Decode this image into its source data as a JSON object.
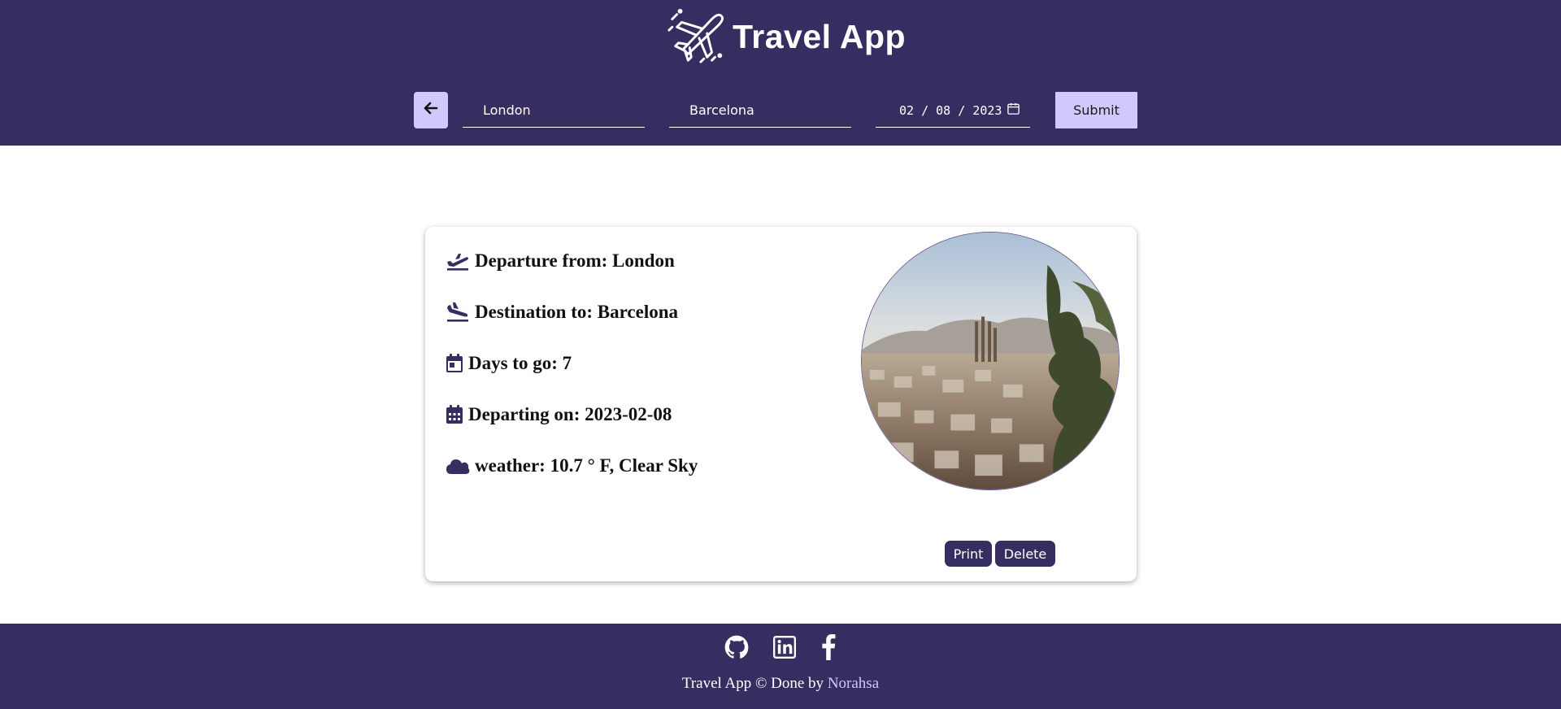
{
  "colors": {
    "brand_bg": "#382d60",
    "accent": "#cfcafb",
    "text_dark": "#111111",
    "white": "#ffffff"
  },
  "header": {
    "logo_icon": "airplane-icon",
    "title": "Travel App"
  },
  "search": {
    "back_icon": "arrow-left-icon",
    "from_value": "London",
    "to_value": "Barcelona",
    "date_value": "02 / 08 / 2023",
    "date_icon": "calendar-icon",
    "submit_label": "Submit"
  },
  "trip": {
    "rows": [
      {
        "icon": "plane-departure-icon",
        "text": "Departure from: London"
      },
      {
        "icon": "plane-arrival-icon",
        "text": "Destination to: Barcelona"
      },
      {
        "icon": "calendar-day-icon",
        "text": "Days to go: 7"
      },
      {
        "icon": "calendar-days-icon",
        "text": "Departing on: 2023-02-08"
      },
      {
        "icon": "cloud-icon",
        "text": "weather: 10.7 ° F, Clear Sky"
      }
    ],
    "photo_icon": "city-photo",
    "print_label": "Print",
    "delete_label": "Delete"
  },
  "footer": {
    "social": [
      "github-icon",
      "linkedin-icon",
      "facebook-icon"
    ],
    "credit_prefix": "Travel App © Done by ",
    "author": "Norahsa"
  }
}
